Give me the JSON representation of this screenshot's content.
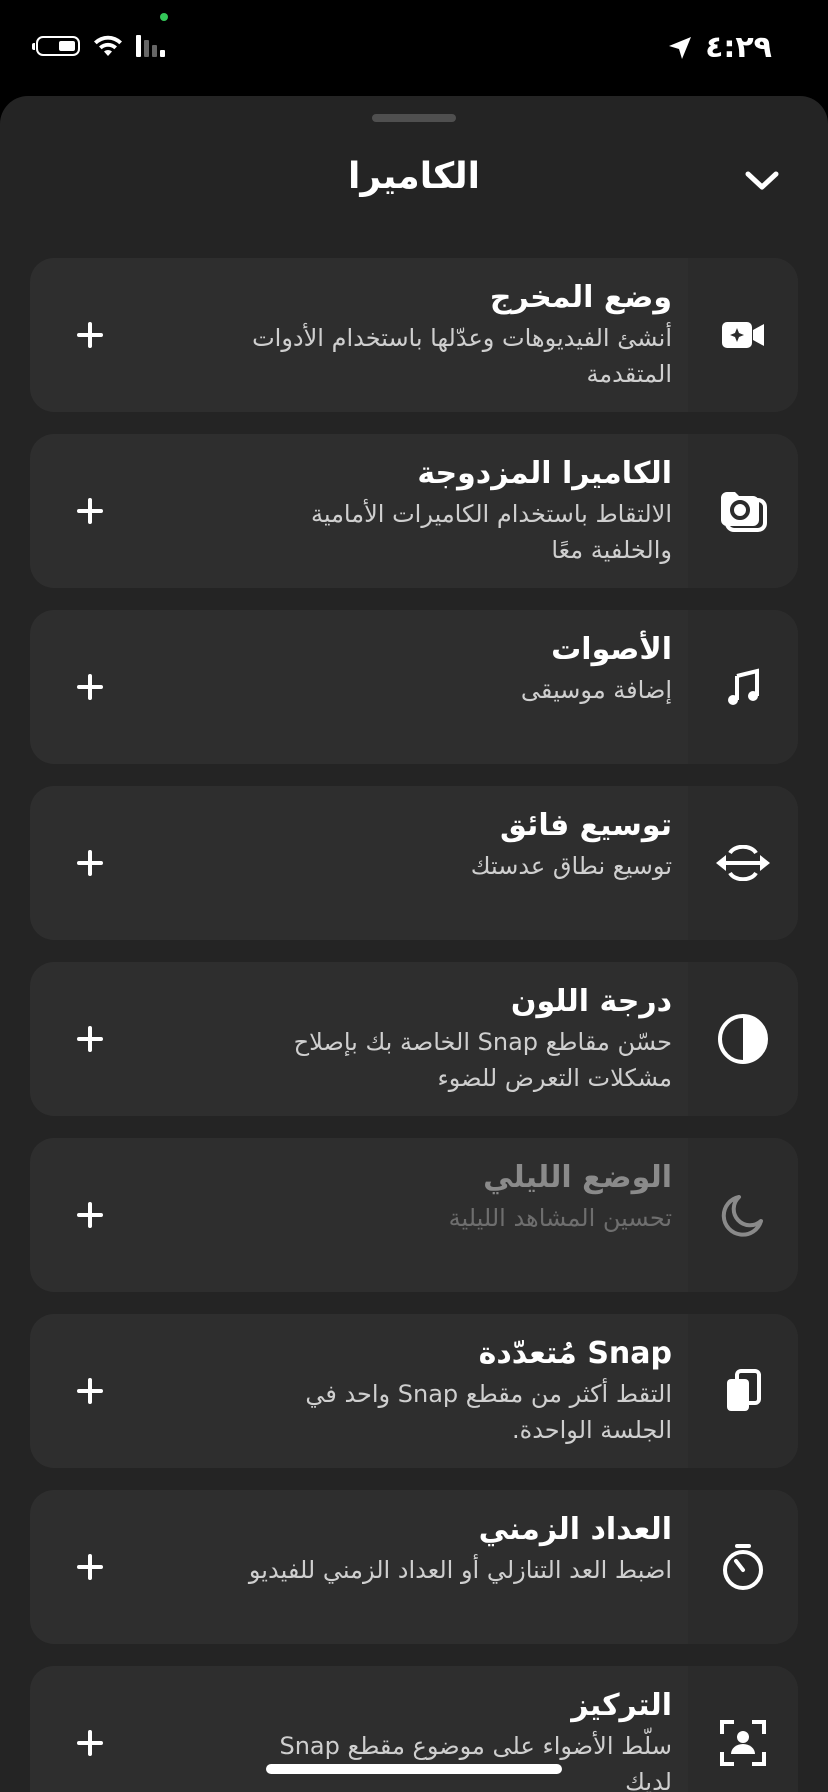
{
  "status_bar": {
    "time": "٤:٢٩",
    "icons": [
      "location-arrow-icon",
      "battery-icon",
      "wifi-icon",
      "cellular-signal-icon"
    ]
  },
  "sheet": {
    "title": "الكاميرا",
    "collapse_icon": "chevron-down-icon"
  },
  "items": [
    {
      "title": "وضع المخرج",
      "description": "أنشئ الفيديوهات وعدّلها باستخدام الأدوات المتقدمة",
      "icon": "director-mode-icon",
      "add_icon": "plus-icon"
    },
    {
      "title": "الكاميرا المزدوجة",
      "description": "الالتقاط باستخدام الكاميرات الأمامية والخلفية معًا",
      "icon": "dual-camera-icon",
      "add_icon": "plus-icon"
    },
    {
      "title": "الأصوات",
      "description": "إضافة موسيقى",
      "icon": "music-note-icon",
      "add_icon": "plus-icon"
    },
    {
      "title": "توسيع فائق",
      "description": "توسيع نطاق عدستك",
      "icon": "ultra-wide-icon",
      "add_icon": "plus-icon"
    },
    {
      "title": "درجة اللون",
      "description": "حسّن مقاطع Snap الخاصة بك بإصلاح مشكلات التعرض للضوء",
      "icon": "tone-icon",
      "add_icon": "plus-icon"
    },
    {
      "title": "الوضع الليلي",
      "description": "تحسين المشاهد الليلية",
      "icon": "moon-icon",
      "add_icon": "plus-icon",
      "disabled": true
    },
    {
      "title": "Snap مُتعدّدة",
      "description": "التقط أكثر من مقطع Snap واحد في الجلسة الواحدة.",
      "icon": "multi-snap-icon",
      "add_icon": "plus-icon"
    },
    {
      "title": "العداد الزمني",
      "description": "اضبط العد التنازلي أو العداد الزمني للفيديو",
      "icon": "timer-icon",
      "add_icon": "plus-icon"
    },
    {
      "title": "التركيز",
      "description": "سلّط الأضواء على موضوع مقطع Snap لديك",
      "icon": "focus-icon",
      "add_icon": "plus-icon"
    }
  ]
}
